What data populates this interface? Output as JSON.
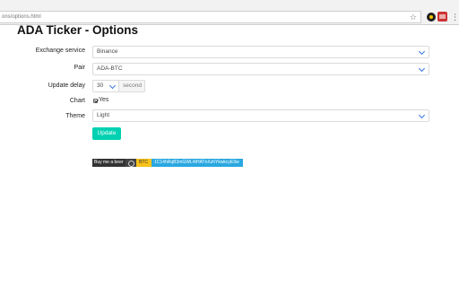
{
  "browser": {
    "url": "ons/options.html",
    "star_icon": "star-icon",
    "menu_icon": "kebab-menu-icon"
  },
  "page": {
    "title": "ADA Ticker - Options"
  },
  "form": {
    "exchange": {
      "label": "Exchange service",
      "value": "Binance"
    },
    "pair": {
      "label": "Pair",
      "value": "ADA-BTC"
    },
    "delay": {
      "label": "Update delay",
      "value": "30",
      "unit": "second"
    },
    "chart": {
      "label": "Chart",
      "checkbox_label": "Yes",
      "checked": true
    },
    "theme": {
      "label": "Theme",
      "value": "Light"
    },
    "update_button": "Update"
  },
  "donate": {
    "beer_label": "Buy me a beer",
    "coin_label": "BTC",
    "address": "1C14hRqB3mGWL4tHATnXzhYkwkcyE9w"
  },
  "colors": {
    "button": "#00d1b2",
    "chevron": "#3273dc",
    "badge_btc": "#f7c21a",
    "badge_address": "#2aa8e0"
  }
}
